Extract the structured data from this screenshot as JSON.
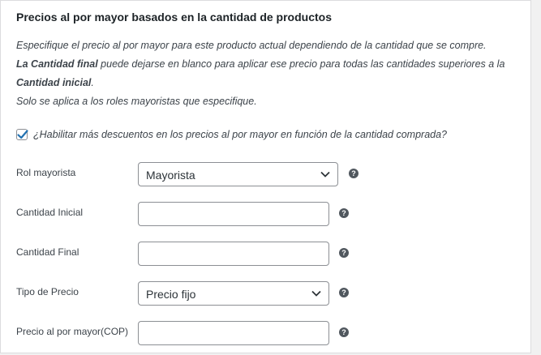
{
  "section": {
    "title": "Precios al por mayor basados en la cantidad de productos"
  },
  "description": {
    "line1": "Especifique el precio al por mayor para este producto actual dependiendo de la cantidad que se compre.",
    "line2_bold1": "La Cantidad final",
    "line2_rest": " puede dejarse en blanco para aplicar ese precio para todas las cantidades superiores a la ",
    "line2_bold2": "Cantidad inicial",
    "line2_end": ".",
    "line3": "Solo se aplica a los roles mayoristas que especifique."
  },
  "enable_checkbox": {
    "label": "¿Habilitar más descuentos en los precios al por mayor en función de la cantidad comprada?",
    "checked": true
  },
  "fields": {
    "rol": {
      "label": "Rol mayorista",
      "value": "Mayorista"
    },
    "cantidad_inicial": {
      "label": "Cantidad Inicial",
      "value": ""
    },
    "cantidad_final": {
      "label": "Cantidad Final",
      "value": ""
    },
    "tipo_precio": {
      "label": "Tipo de Precio",
      "value": "Precio fijo"
    },
    "precio": {
      "label": "Precio al por mayor(COP)",
      "value": ""
    }
  },
  "help_icon": "?",
  "colors": {
    "accent": "#2271b1",
    "help_icon_bg": "#50575e"
  }
}
